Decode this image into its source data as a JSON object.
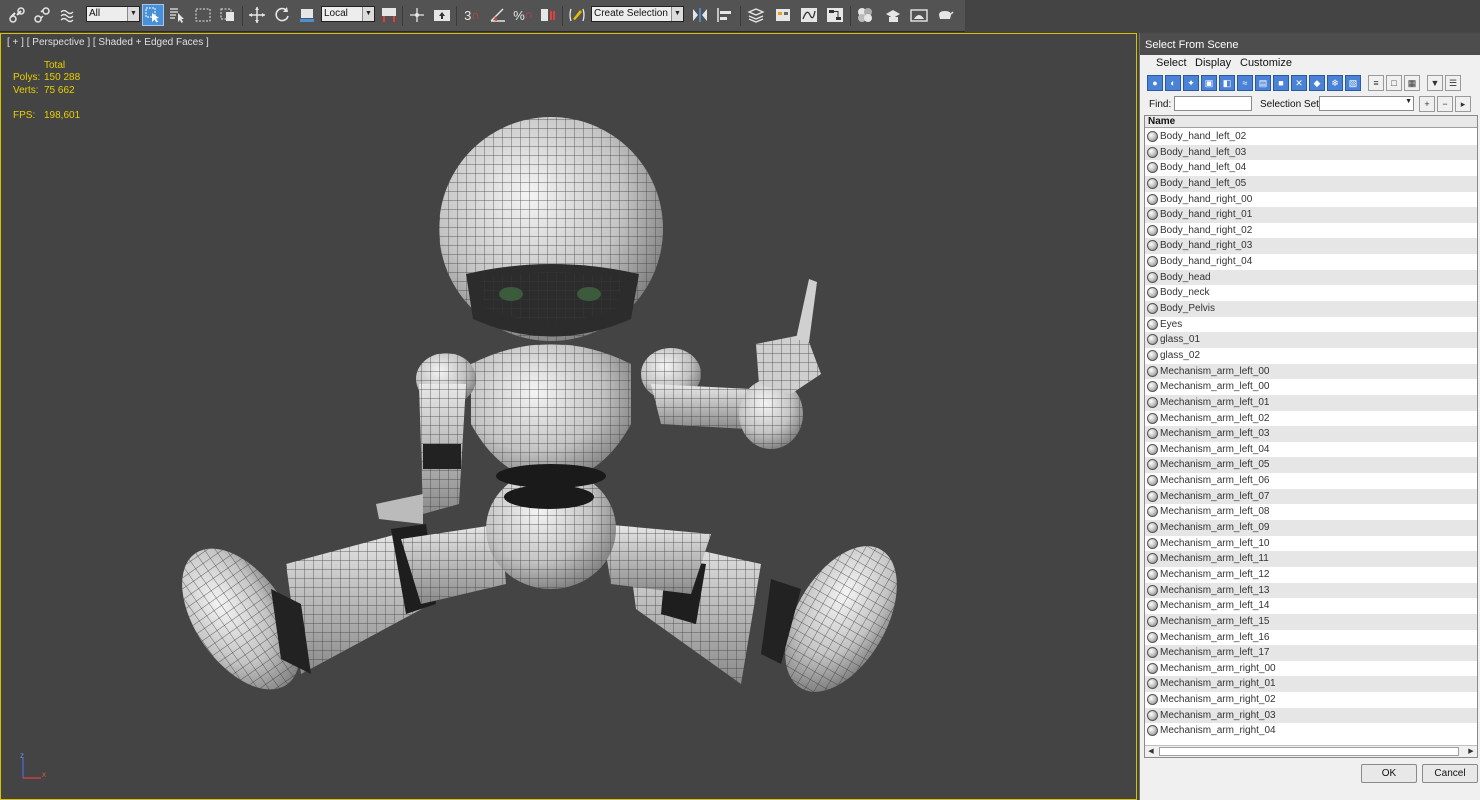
{
  "toolbar": {
    "filter_value": "All",
    "coord_value": "Local",
    "snap_label": "3",
    "selection_set_value": "Create Selection Se",
    "icons": [
      "link-icon",
      "unlink-icon",
      "bind-spacewarp-icon",
      "select-object-icon",
      "select-by-name-icon",
      "rect-region-icon",
      "window-crossing-icon",
      "move-icon",
      "rotate-icon",
      "scale-icon",
      "pivot-icon",
      "manipulate-icon",
      "keyboard-shortcut-icon",
      "snap-toggle-icon",
      "angle-snap-icon",
      "percent-snap-icon",
      "spinner-snap-icon",
      "edit-named-selection-icon",
      "mirror-icon",
      "align-icon",
      "layer-manager-icon",
      "scene-explorer-icon",
      "curve-editor-icon",
      "schematic-view-icon",
      "material-editor-icon",
      "render-setup-icon",
      "rendered-frame-icon",
      "render-icon",
      "render-iterative-icon"
    ]
  },
  "viewport": {
    "label": "[ + ] [ Perspective ] [ Shaded + Edged Faces ]",
    "stats": {
      "total_label": "Total",
      "polys_label": "Polys:",
      "polys_value": "150 288",
      "verts_label": "Verts:",
      "verts_value": "75 662",
      "fps_label": "FPS:",
      "fps_value": "198,601"
    },
    "gizmo": {
      "z": "z",
      "x": "x"
    }
  },
  "dialog": {
    "title": "Select From Scene",
    "menu": [
      "Select",
      "Display",
      "Customize"
    ],
    "find_label": "Find:",
    "selection_set_label": "Selection Set:",
    "column_header": "Name",
    "items": [
      "Body_hand_left_02",
      "Body_hand_left_03",
      "Body_hand_left_04",
      "Body_hand_left_05",
      "Body_hand_right_00",
      "Body_hand_right_01",
      "Body_hand_right_02",
      "Body_hand_right_03",
      "Body_hand_right_04",
      "Body_head",
      "Body_neck",
      "Body_Pelvis",
      "Eyes",
      "glass_01",
      "glass_02",
      "Mechanism_arm_left_00",
      "Mechanism_arm_left_00",
      "Mechanism_arm_left_01",
      "Mechanism_arm_left_02",
      "Mechanism_arm_left_03",
      "Mechanism_arm_left_04",
      "Mechanism_arm_left_05",
      "Mechanism_arm_left_06",
      "Mechanism_arm_left_07",
      "Mechanism_arm_left_08",
      "Mechanism_arm_left_09",
      "Mechanism_arm_left_10",
      "Mechanism_arm_left_11",
      "Mechanism_arm_left_12",
      "Mechanism_arm_left_13",
      "Mechanism_arm_left_14",
      "Mechanism_arm_left_15",
      "Mechanism_arm_left_16",
      "Mechanism_arm_left_17",
      "Mechanism_arm_right_00",
      "Mechanism_arm_right_01",
      "Mechanism_arm_right_02",
      "Mechanism_arm_right_03",
      "Mechanism_arm_right_04"
    ],
    "ok_label": "OK",
    "cancel_label": "Cancel"
  },
  "colors": {
    "viewport_bg": "#444444",
    "active_border": "#d8c200",
    "stats_text": "#e8d000",
    "accent_blue": "#4a82d6"
  }
}
